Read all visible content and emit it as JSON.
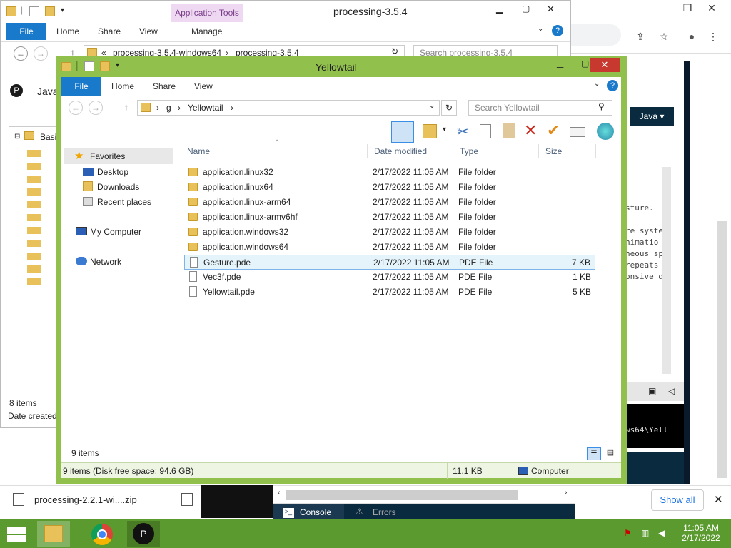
{
  "back_window": {
    "title": "processing-3.5.4",
    "context_tab": "Application Tools",
    "tabs": [
      "File",
      "Home",
      "Share",
      "View",
      "Manage"
    ],
    "address": [
      "«",
      "processing-3.5.4-windows64",
      "›",
      "processing-3.5.4"
    ],
    "search_placeholder": "Search processing-3.5.4",
    "item_count": "8 items",
    "date_created": "Date created:"
  },
  "processing_app": {
    "mode_label": "Java",
    "mode_button": "Java ▾",
    "tree_root": "Basi",
    "text_lines": [
      "sture.",
      "re syste",
      "nimatio",
      "neous sp",
      "repeats",
      "onsive d"
    ],
    "console_path": "ws64\\Yell",
    "console_tab": "Console",
    "errors_tab": "Errors"
  },
  "main_window": {
    "title": "Yellowtail",
    "tabs": [
      "File",
      "Home",
      "Share",
      "View"
    ],
    "breadcrumb": [
      "g",
      "Yellowtail"
    ],
    "search_placeholder": "Search Yellowtail",
    "nav": {
      "favorites": "Favorites",
      "desktop": "Desktop",
      "downloads": "Downloads",
      "recent": "Recent places",
      "computer": "My Computer",
      "network": "Network"
    },
    "columns": [
      "Name",
      "Date modified",
      "Type",
      "Size"
    ],
    "files": [
      {
        "name": "application.linux32",
        "date": "2/17/2022 11:05 AM",
        "type": "File folder",
        "size": "",
        "kind": "folder"
      },
      {
        "name": "application.linux64",
        "date": "2/17/2022 11:05 AM",
        "type": "File folder",
        "size": "",
        "kind": "folder"
      },
      {
        "name": "application.linux-arm64",
        "date": "2/17/2022 11:05 AM",
        "type": "File folder",
        "size": "",
        "kind": "folder"
      },
      {
        "name": "application.linux-armv6hf",
        "date": "2/17/2022 11:05 AM",
        "type": "File folder",
        "size": "",
        "kind": "folder"
      },
      {
        "name": "application.windows32",
        "date": "2/17/2022 11:05 AM",
        "type": "File folder",
        "size": "",
        "kind": "folder"
      },
      {
        "name": "application.windows64",
        "date": "2/17/2022 11:05 AM",
        "type": "File folder",
        "size": "",
        "kind": "folder"
      },
      {
        "name": "Gesture.pde",
        "date": "2/17/2022 11:05 AM",
        "type": "PDE File",
        "size": "7 KB",
        "kind": "file"
      },
      {
        "name": "Vec3f.pde",
        "date": "2/17/2022 11:05 AM",
        "type": "PDE File",
        "size": "1 KB",
        "kind": "file"
      },
      {
        "name": "Yellowtail.pde",
        "date": "2/17/2022 11:05 AM",
        "type": "PDE File",
        "size": "5 KB",
        "kind": "file"
      }
    ],
    "item_count": "9 items",
    "status_left": "9 items (Disk free space: 94.6 GB)",
    "status_size": "11.1 KB",
    "status_location": "Computer"
  },
  "downloads_bar": {
    "file": "processing-2.2.1-wi....zip",
    "show_all": "Show all"
  },
  "taskbar": {
    "time": "11:05 AM",
    "date": "2/17/2022"
  },
  "colors": {
    "accent": "#1979ca",
    "window_frame": "#91c14c",
    "taskbar": "#5a9a2e",
    "selection": "#e5f3fb"
  }
}
